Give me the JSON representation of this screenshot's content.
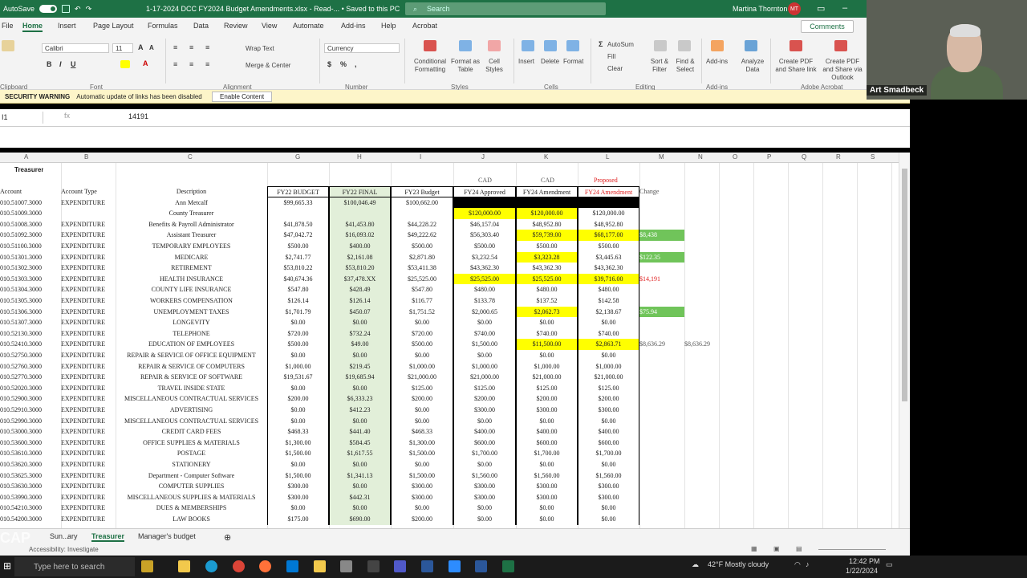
{
  "titlebar": {
    "autosave": "AutoSave",
    "autosave_state": "On",
    "document": "1-17-2024 DCC FY2024 Budget Amendments.xlsx - Read-...  •  Saved to this PC",
    "search_placeholder": "Search",
    "user": "Martina Thornton",
    "user_initials": "MT"
  },
  "menu": [
    "File",
    "Home",
    "Insert",
    "Page Layout",
    "Formulas",
    "Data",
    "Review",
    "View",
    "Automate",
    "Add-ins",
    "Help",
    "Acrobat"
  ],
  "comments": "Comments",
  "ribbon": {
    "font_name": "Calibri",
    "font_size": "11",
    "wrap_text": "Wrap Text",
    "merge_center": "Merge & Center",
    "number_format": "Currency",
    "conditional_formatting": "Conditional Formatting",
    "format_as_table": "Format as Table",
    "cell_styles": "Cell Styles",
    "insert": "Insert",
    "delete": "Delete",
    "format": "Format",
    "autosum": "AutoSum",
    "fill": "Fill",
    "clear": "Clear",
    "sort_filter": "Sort & Filter",
    "find_select": "Find & Select",
    "addins": "Add-ins",
    "analyze_data": "Analyze Data",
    "create_pdf_share": "Create PDF and Share link",
    "create_pdf_outlook": "Create PDF and Share via Outlook",
    "groups": {
      "clipboard": "Clipboard",
      "font": "Font",
      "alignment": "Alignment",
      "number": "Number",
      "styles": "Styles",
      "cells": "Cells",
      "editing": "Editing",
      "addins": "Add-ins",
      "acrobat": "Adobe Acrobat"
    }
  },
  "security": {
    "label": "SECURITY WARNING",
    "message": "Automatic update of links has been disabled",
    "button": "Enable Content"
  },
  "formula": {
    "namebox": "I1",
    "fx": "fx",
    "value": "14191"
  },
  "columns": [
    "A",
    "B",
    "C",
    "G",
    "H",
    "I",
    "J",
    "K",
    "L",
    "M",
    "N",
    "O",
    "P",
    "Q",
    "R",
    "S"
  ],
  "sheet": {
    "title": "Treasurer",
    "cad_j": "CAD",
    "cad_k": "CAD",
    "proposed": "Proposed",
    "headers": [
      "Account",
      "Account Type",
      "Description",
      "FY22 BUDGET",
      "FY22 FINAL",
      "FY23 Budget",
      "FY24 Approved",
      "FY24 Amendment",
      "FY24 Amendment",
      "Change"
    ],
    "rows": [
      [
        "010.51007.3000",
        "EXPENDITURE",
        "Ann Metcalf",
        "$99,665.33",
        "$100,046.49",
        "$100,662.00",
        "",
        "",
        "",
        "",
        ""
      ],
      [
        "010.51009.3000",
        "",
        "County Treasurer",
        "",
        "",
        "",
        "$120,000.00",
        "$120,000.00",
        "$120,000.00",
        "",
        ""
      ],
      [
        "010.51008.3000",
        "EXPENDITURE",
        "Benefits & Payroll Administrator",
        "$41,878.50",
        "$41,453.80",
        "$44,228.22",
        "$46,157.04",
        "$48,952.80",
        "$48,952.80",
        "",
        ""
      ],
      [
        "010.51092.3000",
        "EXPENDITURE",
        "Assistant Treasurer",
        "$47,042.72",
        "$16,093.02",
        "$49,222.62",
        "$56,303.40",
        "$59,739.00",
        "$68,177.00",
        "$8,438",
        ""
      ],
      [
        "010.51100.3000",
        "EXPENDITURE",
        "TEMPORARY EMPLOYEES",
        "$500.00",
        "$400.00",
        "$500.00",
        "$500.00",
        "$500.00",
        "$500.00",
        "",
        ""
      ],
      [
        "010.51301.3000",
        "EXPENDITURE",
        "MEDICARE",
        "$2,741.77",
        "$2,161.08",
        "$2,871.80",
        "$3,232.54",
        "$3,323.28",
        "$3,445.63",
        "$122.35",
        ""
      ],
      [
        "010.51302.3000",
        "EXPENDITURE",
        "RETIREMENT",
        "$53,810.22",
        "$53,810.20",
        "$53,411.38",
        "$43,362.30",
        "$43,362.30",
        "$43,362.30",
        "",
        ""
      ],
      [
        "010.51303.3000",
        "EXPENDITURE",
        "HEALTH INSURANCE",
        "$40,674.36",
        "$37,478.XX",
        "$25,525.00",
        "$25,525.00",
        "$25,525.00",
        "$39,716.00",
        "$14,191",
        ""
      ],
      [
        "010.51304.3000",
        "EXPENDITURE",
        "COUNTY LIFE INSURANCE",
        "$547.80",
        "$428.49",
        "$547.80",
        "$480.00",
        "$480.00",
        "$480.00",
        "",
        ""
      ],
      [
        "010.51305.3000",
        "EXPENDITURE",
        "WORKERS COMPENSATION",
        "$126.14",
        "$126.14",
        "$116.77",
        "$133.78",
        "$137.52",
        "$142.58",
        "",
        ""
      ],
      [
        "010.51306.3000",
        "EXPENDITURE",
        "UNEMPLOYMENT TAXES",
        "$1,701.79",
        "$450.07",
        "$1,751.52",
        "$2,000.65",
        "$2,062.73",
        "$2,138.67",
        "$75.94",
        ""
      ],
      [
        "010.51307.3000",
        "EXPENDITURE",
        "LONGEVITY",
        "$0.00",
        "$0.00",
        "$0.00",
        "$0.00",
        "$0.00",
        "$0.00",
        "",
        ""
      ],
      [
        "010.52130.3000",
        "EXPENDITURE",
        "TELEPHONE",
        "$720.00",
        "$732.24",
        "$720.00",
        "$740.00",
        "$740.00",
        "$740.00",
        "",
        ""
      ],
      [
        "010.52410.3000",
        "EXPENDITURE",
        "EDUCATION OF EMPLOYEES",
        "$500.00",
        "$49.00",
        "$500.00",
        "$1,500.00",
        "$11,500.00",
        "$2,863.71",
        "$8,636.29",
        "$8,636.29"
      ],
      [
        "010.52750.3000",
        "EXPENDITURE",
        "REPAIR & SERVICE OF OFFICE EQUIPMENT",
        "$0.00",
        "$0.00",
        "$0.00",
        "$0.00",
        "$0.00",
        "$0.00",
        "",
        ""
      ],
      [
        "010.52760.3000",
        "EXPENDITURE",
        "REPAIR & SERVICE OF COMPUTERS",
        "$1,000.00",
        "$219.45",
        "$1,000.00",
        "$1,000.00",
        "$1,000.00",
        "$1,000.00",
        "",
        ""
      ],
      [
        "010.52770.3000",
        "EXPENDITURE",
        "REPAIR & SERVICE OF SOFTWARE",
        "$19,531.67",
        "$19,685.94",
        "$21,000.00",
        "$21,000.00",
        "$21,000.00",
        "$21,000.00",
        "",
        ""
      ],
      [
        "010.52020.3000",
        "EXPENDITURE",
        "TRAVEL INSIDE STATE",
        "$0.00",
        "$0.00",
        "$125.00",
        "$125.00",
        "$125.00",
        "$125.00",
        "",
        ""
      ],
      [
        "010.52900.3000",
        "EXPENDITURE",
        "MISCELLANEOUS CONTRACTUAL SERVICES",
        "$200.00",
        "$6,333.23",
        "$200.00",
        "$200.00",
        "$200.00",
        "$200.00",
        "",
        ""
      ],
      [
        "010.52910.3000",
        "EXPENDITURE",
        "ADVERTISING",
        "$0.00",
        "$412.23",
        "$0.00",
        "$300.00",
        "$300.00",
        "$300.00",
        "",
        ""
      ],
      [
        "010.52990.3000",
        "EXPENDITURE",
        "MISCELLANEOUS CONTRACTUAL SERVICES",
        "$0.00",
        "$0.00",
        "$0.00",
        "$0.00",
        "$0.00",
        "$0.00",
        "",
        ""
      ],
      [
        "010.53000.3000",
        "EXPENDITURE",
        "CREDIT CARD FEES",
        "$468.33",
        "$441.40",
        "$468.33",
        "$400.00",
        "$400.00",
        "$400.00",
        "",
        ""
      ],
      [
        "010.53600.3000",
        "EXPENDITURE",
        "OFFICE SUPPLIES & MATERIALS",
        "$1,300.00",
        "$584.45",
        "$1,300.00",
        "$600.00",
        "$600.00",
        "$600.00",
        "",
        ""
      ],
      [
        "010.53610.3000",
        "EXPENDITURE",
        "POSTAGE",
        "$1,500.00",
        "$1,617.55",
        "$1,500.00",
        "$1,700.00",
        "$1,700.00",
        "$1,700.00",
        "",
        ""
      ],
      [
        "010.53620.3000",
        "EXPENDITURE",
        "STATIONERY",
        "$0.00",
        "$0.00",
        "$0.00",
        "$0.00",
        "$0.00",
        "$0.00",
        "",
        ""
      ],
      [
        "010.53625.3000",
        "EXPENDITURE",
        "Department - Computer Software",
        "$1,500.00",
        "$1,341.13",
        "$1,500.00",
        "$1,560.00",
        "$1,560.00",
        "$1,560.00",
        "",
        ""
      ],
      [
        "010.53630.3000",
        "EXPENDITURE",
        "COMPUTER SUPPLIES",
        "$300.00",
        "$0.00",
        "$300.00",
        "$300.00",
        "$300.00",
        "$300.00",
        "",
        ""
      ],
      [
        "010.53990.3000",
        "EXPENDITURE",
        "MISCELLANEOUS SUPPLIES & MATERIALS",
        "$300.00",
        "$442.31",
        "$300.00",
        "$300.00",
        "$300.00",
        "$300.00",
        "",
        ""
      ],
      [
        "010.54210.3000",
        "EXPENDITURE",
        "DUES & MEMBERSHIPS",
        "$0.00",
        "$0.00",
        "$0.00",
        "$0.00",
        "$0.00",
        "$0.00",
        "",
        ""
      ],
      [
        "010.54200.3000",
        "EXPENDITURE",
        "LAW BOOKS",
        "$175.00",
        "$690.00",
        "$200.00",
        "$0.00",
        "$0.00",
        "$0.00",
        "",
        ""
      ]
    ]
  },
  "sheet_tabs": [
    "Sun...",
    "ary",
    "Treasurer",
    "Manager's budget"
  ],
  "active_tab": "Treasurer",
  "status": "Accessibility: Investigate",
  "watermark": "CAP",
  "taskbar": {
    "search": "Type here to search",
    "weather": "42°F  Mostly cloudy",
    "time": "12:42 PM",
    "date": "1/22/2024"
  },
  "video": {
    "name": "Art Smadbeck"
  },
  "colors": {
    "excel_green": "#1e7145",
    "yellow": "#ffff00",
    "light_green": "#e2efd9",
    "dark_green": "#70c45a",
    "red_text": "#e02020"
  }
}
